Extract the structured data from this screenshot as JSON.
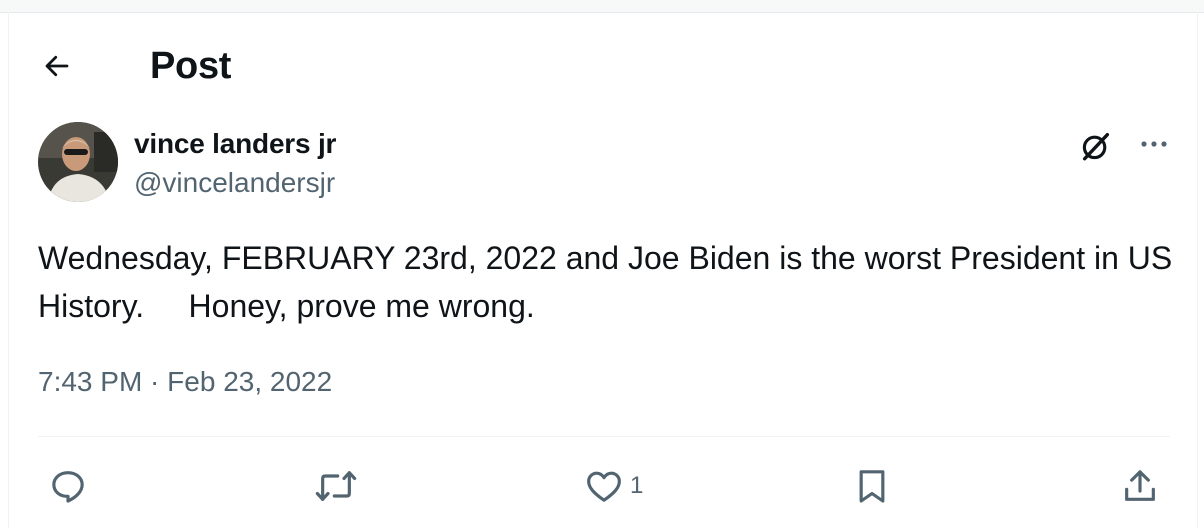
{
  "header": {
    "title": "Post"
  },
  "author": {
    "name": "vince landers jr",
    "handle": "@vincelandersjr"
  },
  "post": {
    "text": "Wednesday, FEBRUARY 23rd, 2022 and Joe Biden is the worst President in US History.     Honey, prove me wrong.",
    "time": "7:43 PM",
    "separator": " · ",
    "date": "Feb 23, 2022"
  },
  "actions": {
    "reply_icon": "speech-bubble",
    "repost_icon": "repost-arrows",
    "like_icon": "heart",
    "like_count": "1",
    "bookmark_icon": "bookmark",
    "share_icon": "share-upload"
  },
  "colors": {
    "text": "#0f1419",
    "secondary": "#536471",
    "divider": "#eff3f4"
  }
}
